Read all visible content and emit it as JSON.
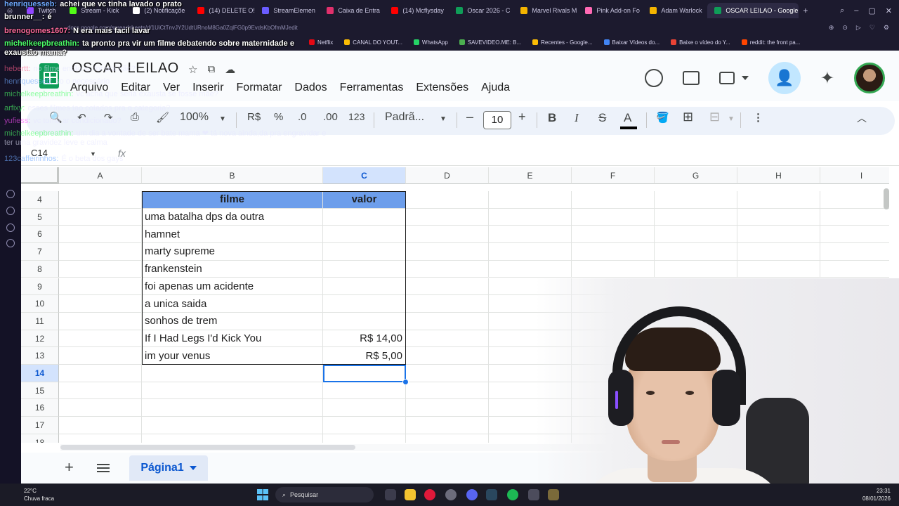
{
  "browser": {
    "tabs": [
      {
        "label": "Twitch",
        "color": "#9146ff"
      },
      {
        "label": "Stream - Kick",
        "color": "#53fc18"
      },
      {
        "label": "(2) Notificaçõe",
        "color": "#ffffff"
      },
      {
        "label": "(14) DELETE O!",
        "color": "#ff0000"
      },
      {
        "label": "StreamElemen",
        "color": "#6a5cff"
      },
      {
        "label": "Caixa de Entra",
        "color": "#e1306c"
      },
      {
        "label": "(14) Mcflysday",
        "color": "#ff0000"
      },
      {
        "label": "Oscar 2026 - C",
        "color": "#0f9d58"
      },
      {
        "label": "Marvel Rivals M",
        "color": "#f4b400"
      },
      {
        "label": "Pink Add-on Fo",
        "color": "#ff69b4"
      },
      {
        "label": "Adam Warlock",
        "color": "#f4b400"
      },
      {
        "label": "OSCAR LEILAO - Google",
        "color": "#0f9d58"
      }
    ],
    "url": "docs.google.com/spreadsheets/d/1UiCtTnvJY2UdtURnoM8Ga0ZqlFG0p9EvdsKbOfmMJedit",
    "bookmarks": [
      {
        "label": "Netflix",
        "color": "#e50914"
      },
      {
        "label": "CANAL DO YOUT...",
        "color": "#fbbc04"
      },
      {
        "label": "WhatsApp",
        "color": "#25d366"
      },
      {
        "label": "SAVEVIDEO.ME: B...",
        "color": "#4caf50"
      },
      {
        "label": "Recentes - Google...",
        "color": "#fbbc04"
      },
      {
        "label": "Baixar Vídeos do...",
        "color": "#4285f4"
      },
      {
        "label": "Baixe o vídeo do Y...",
        "color": "#ea4335"
      },
      {
        "label": "reddit: the front pa...",
        "color": "#ff4500"
      }
    ]
  },
  "sheets": {
    "doc_title": "OSCAR LEILAO",
    "menu": [
      "Arquivo",
      "Editar",
      "Ver",
      "Inserir",
      "Formatar",
      "Dados",
      "Ferramentas",
      "Extensões",
      "Ajuda"
    ],
    "toolbar": {
      "zoom": "100%",
      "currency": "R$",
      "percent": "%",
      "dec_less": ".0",
      "dec_more": ".00",
      "num_format": "123",
      "font": "Padrã...",
      "font_size": "10",
      "minus": "–",
      "plus": "+",
      "bold": "B",
      "italic": "I",
      "strike": "S",
      "text_color": "A"
    },
    "name_box": "C14",
    "fx": "fx",
    "columns": [
      "A",
      "B",
      "C",
      "D",
      "E",
      "F",
      "G",
      "H",
      "I"
    ],
    "selected_column": "C",
    "rows": [
      "4",
      "5",
      "6",
      "7",
      "8",
      "9",
      "10",
      "11",
      "12",
      "13",
      "14",
      "15",
      "16",
      "17",
      "18"
    ],
    "selected_row": "14",
    "table": {
      "header": {
        "filme": "filme",
        "valor": "valor"
      },
      "entries": [
        {
          "filme": "uma batalha dps da outra",
          "valor": ""
        },
        {
          "filme": "hamnet",
          "valor": ""
        },
        {
          "filme": "marty supreme",
          "valor": ""
        },
        {
          "filme": "frankenstein",
          "valor": ""
        },
        {
          "filme": "foi apenas um acidente",
          "valor": ""
        },
        {
          "filme": "a unica saida",
          "valor": ""
        },
        {
          "filme": "sonhos de trem",
          "valor": ""
        },
        {
          "filme": "If I Had Legs I'd Kick You",
          "valor": "R$ 14,00"
        },
        {
          "filme": "im your venus",
          "valor": "R$ 5,00"
        }
      ]
    },
    "sheet_tab": "Página1"
  },
  "chat": [
    {
      "user": "henriquesseb:",
      "msg": "achei que vc tinha lavado o prato",
      "color": "#6ea8ff",
      "faded": false
    },
    {
      "user": "brunner__:",
      "msg": "é",
      "color": "#ffffff",
      "faded": false
    },
    {
      "user": "brenogomes1607:",
      "msg": "N era mais facil lavar",
      "color": "#ff6b9d",
      "faded": false
    },
    {
      "user": "michelkeepbreathin:",
      "msg": "ta pronto pra vir um filme debatendo sobre maternidade e exaustão mama?",
      "color": "#4cff6a",
      "faded": false
    },
    {
      "user": "hebertt:",
      "msg": "no filme então vc for pra não?",
      "color": "#ff5c8a",
      "faded": true
    },
    {
      "user": "henriquesseb:",
      "msg": "so o necessário",
      "color": "#6ea8ff",
      "faded": true
    },
    {
      "user": "michelkeepbreathin:",
      "msg": "vc acha que seria exausta se fosse mãe?",
      "color": "#4cff6a",
      "faded": true
    },
    {
      "user": "arfixy:",
      "msg": "esses filmes tao cotados pra q categoria?",
      "color": "#4cff6a",
      "faded": true
    },
    {
      "user": "yufiess:",
      "msg": "vc toma ar condicionado?",
      "color": "#ff4dff",
      "faded": true
    },
    {
      "user": "michelkeepbreathin:",
      "msg": "um dia a vontade de ser bate mama ❤ tá nova ainda,da pra engravidar e ter uma gravidez leve e calma",
      "color": "#4cff6a",
      "faded": true
    },
    {
      "user": "123caffeirinhos:",
      "msg": "É o beta dos gays",
      "color": "#6ea8ff",
      "faded": true
    }
  ],
  "taskbar": {
    "weather_temp": "22°C",
    "weather_desc": "Chuva fraca",
    "search": "Pesquisar",
    "time": "23:31",
    "date": "08/01/2026"
  }
}
